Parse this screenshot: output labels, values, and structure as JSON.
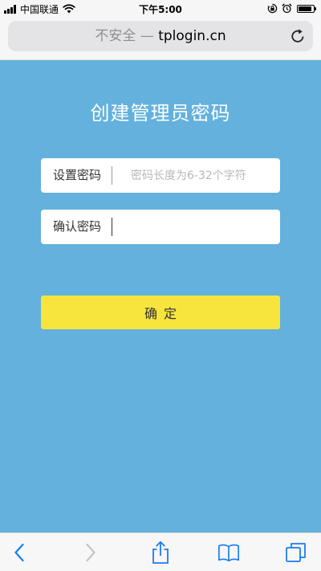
{
  "status_bar": {
    "carrier": "中国联通",
    "time": "下午5:00"
  },
  "address_bar": {
    "security_label": "不安全 — ",
    "domain": "tplogin.cn"
  },
  "page": {
    "title": "创建管理员密码",
    "password_field": {
      "label": "设置密码",
      "placeholder": "密码长度为6-32个字符",
      "value": ""
    },
    "confirm_field": {
      "label": "确认密码",
      "placeholder": "",
      "value": ""
    },
    "confirm_button_label": "确定"
  },
  "colors": {
    "page_background": "#63b1dc",
    "button": "#f7e53d",
    "toolbar_icon": "#1a7cf5",
    "toolbar_icon_disabled": "#c4c4c8"
  },
  "toolbar": {
    "icons": [
      "back-icon",
      "forward-icon",
      "share-icon",
      "bookmarks-icon",
      "tabs-icon"
    ]
  }
}
